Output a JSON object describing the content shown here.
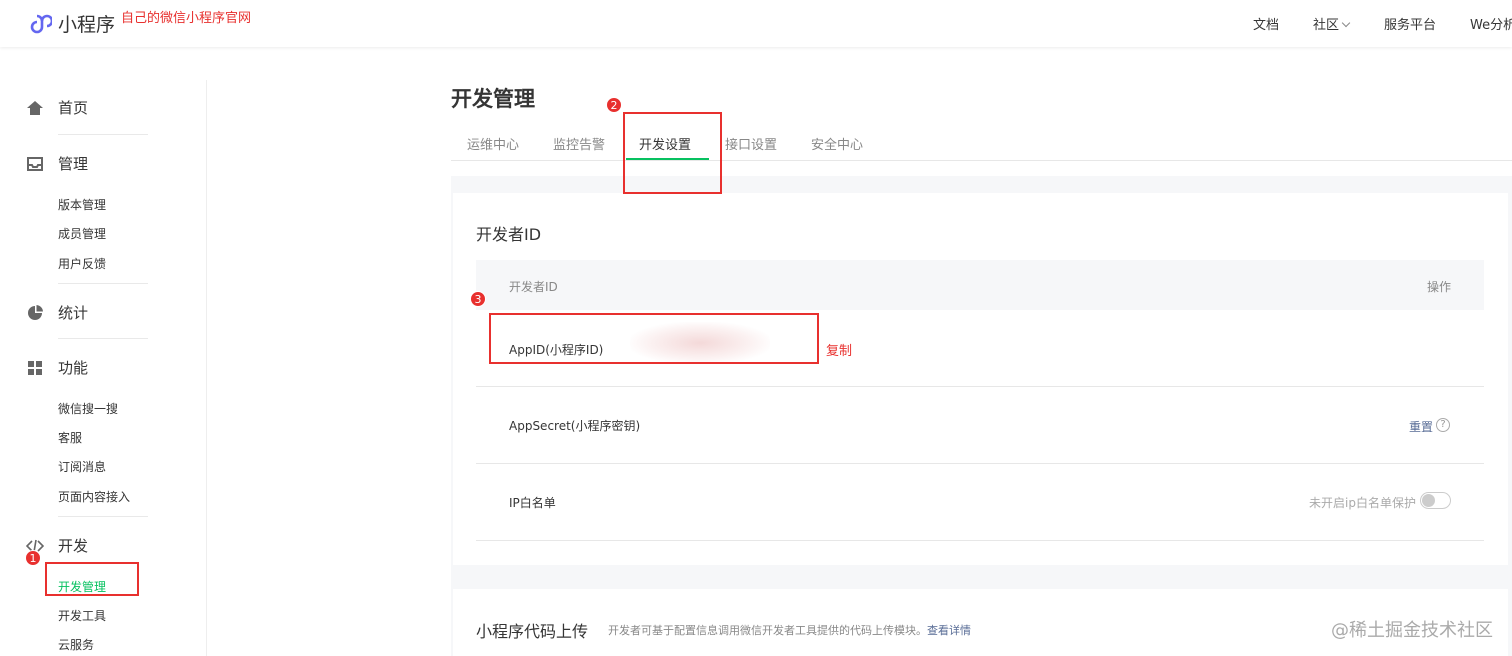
{
  "header": {
    "app_name": "小程序",
    "annotation": "自己的微信小程序官网",
    "nav": {
      "doc": "文档",
      "community": "社区",
      "service": "服务平台",
      "we": "We分析"
    }
  },
  "sidebar": {
    "home": "首页",
    "manage": "管理",
    "manage_items": [
      "版本管理",
      "成员管理",
      "用户反馈"
    ],
    "stats": "统计",
    "features": "功能",
    "feature_items": [
      "微信搜一搜",
      "客服",
      "订阅消息",
      "页面内容接入"
    ],
    "dev": "开发",
    "dev_items": [
      "开发管理",
      "开发工具",
      "云服务"
    ]
  },
  "page": {
    "title": "开发管理",
    "tabs": [
      "运维中心",
      "监控告警",
      "开发设置",
      "接口设置",
      "安全中心"
    ],
    "active_tab": "开发设置"
  },
  "developer_id_card": {
    "title": "开发者ID",
    "col_name": "开发者ID",
    "col_action": "操作",
    "rows": {
      "appid": "AppID(小程序ID)",
      "appsecret": "AppSecret(小程序密钥)",
      "reset": "重置",
      "help": "?",
      "ip_whitelist": "IP白名单",
      "ip_note": "未开启ip白名单保护"
    }
  },
  "upload_card": {
    "title": "小程序代码上传",
    "desc": "开发者可基于配置信息调用微信开发者工具提供的代码上传模块。",
    "link": "查看详情"
  },
  "annotations": {
    "n1": "1",
    "n2": "2",
    "n3": "3",
    "copy": "复制"
  },
  "watermark": "@稀土掘金技术社区",
  "colors": {
    "accent_green": "#07c160",
    "annotation_red": "#e8302e",
    "link_blue": "#576b95"
  }
}
